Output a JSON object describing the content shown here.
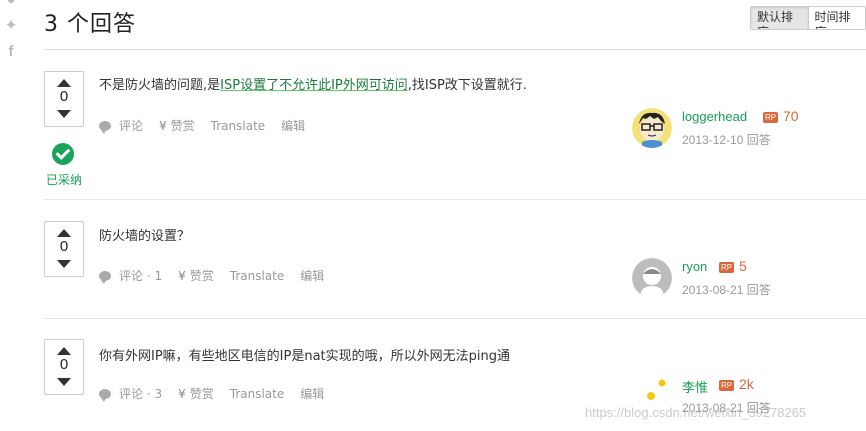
{
  "share_icons": [
    "weibo-icon",
    "twitter-icon",
    "facebook-icon"
  ],
  "answers_title": "3 个回答",
  "sort": {
    "default_label": "默认排序",
    "time_label": "时间排序"
  },
  "answers": [
    {
      "votes": "0",
      "accepted": true,
      "accepted_label": "已采纳",
      "text_before": "不是防火墙的问题,是",
      "link_text": "ISP设置了不允许此IP外网可访问",
      "text_after": ",找ISP改下设置就行.",
      "comment_label": "评论",
      "reward_label": "赞赏",
      "translate_label": "Translate",
      "edit_label": "编辑",
      "author": "loggerhead",
      "rp_badge": "RP",
      "reputation": "70",
      "meta": "2013-12-10 回答"
    },
    {
      "votes": "0",
      "accepted": false,
      "text": "防火墙的设置？",
      "comment_label": "评论 · 1",
      "reward_label": "赞赏",
      "translate_label": "Translate",
      "edit_label": "编辑",
      "author": "ryon",
      "rp_badge": "RP",
      "reputation": "5",
      "meta": "2013-08-21 回答"
    },
    {
      "votes": "0",
      "accepted": false,
      "text": "你有外网IP嘛，有些地区电信的IP是nat实现的哦，所以外网无法ping通",
      "comment_label": "评论 · 3",
      "reward_label": "赞赏",
      "translate_label": "Translate",
      "edit_label": "编辑",
      "author": "李惟",
      "rp_badge": "RP",
      "reputation": "2k",
      "meta": "2013-08-21 回答"
    }
  ],
  "watermark": "https://blog.csdn.net/weixin_39278265",
  "colors": {
    "accent_green": "#1a9d55",
    "rp_orange": "#d9673b"
  }
}
